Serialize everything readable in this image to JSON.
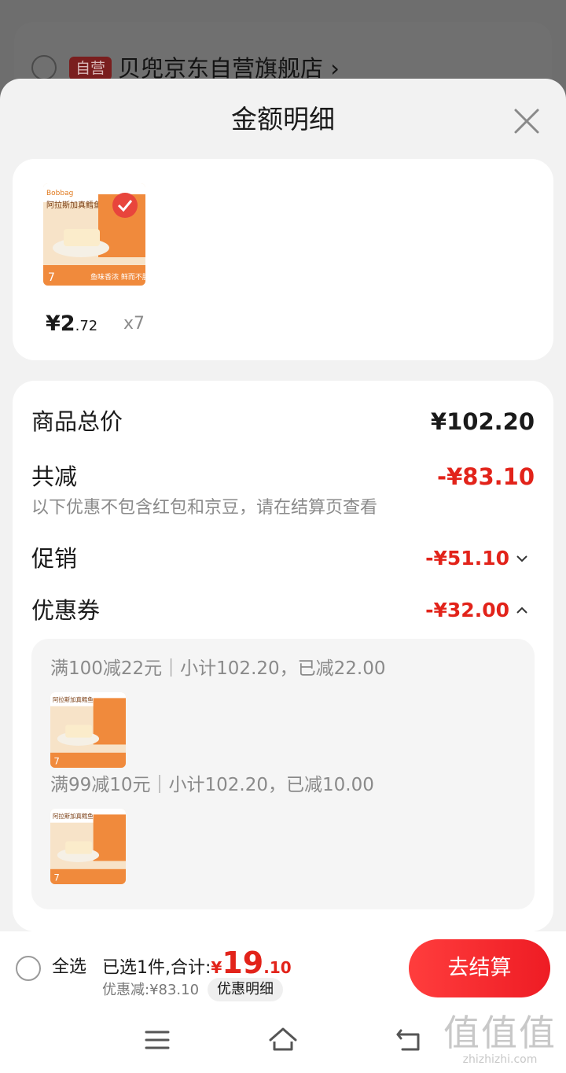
{
  "background": {
    "store_badge": "自营",
    "store_name": "贝兜京东自营旗舰店",
    "store_chevron": "›"
  },
  "sheet": {
    "title": "金额明细",
    "close_icon": "close-icon"
  },
  "product": {
    "price_symbol": "¥",
    "price_int": "2",
    "price_dec": ".72",
    "quantity": "x7",
    "thumbnail_icon": "product-thumbnail"
  },
  "details": {
    "total_label": "商品总价",
    "total_value": "¥102.20",
    "reduce_label": "共减",
    "reduce_value": "-¥83.10",
    "note": "以下优惠不包含红包和京豆，请在结算页查看",
    "promo_label": "促销",
    "promo_value": "-¥51.10",
    "coupon_label": "优惠券",
    "coupon_value": "-¥32.00",
    "coupons": [
      {
        "text": "满100减22元｜小计102.20，已减22.00"
      },
      {
        "text": "满99减10元｜小计102.20，已减10.00"
      }
    ]
  },
  "bottom_bar": {
    "select_all": "全选",
    "summary_prefix": "已选1件,合计:",
    "total_cur": "¥",
    "total_int": "19",
    "total_dec": ".10",
    "discount": "优惠减:¥83.10",
    "detail_chip": "优惠明细",
    "checkout": "去结算"
  },
  "nav": {
    "menu_icon": "menu-icon",
    "home_icon": "home-icon",
    "back_icon": "back-icon"
  },
  "watermark": {
    "glyphs": "值值值",
    "site": "zhizhizhi.com"
  },
  "colors": {
    "accent_red": "#e2231a",
    "sheet_bg": "#f2f2f2"
  }
}
